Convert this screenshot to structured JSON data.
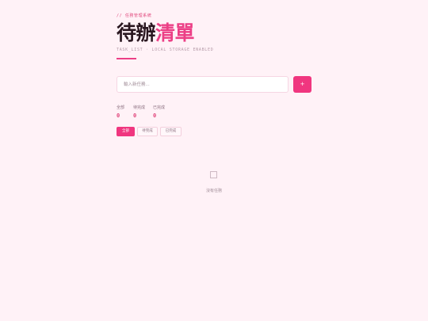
{
  "header": {
    "eyebrow": "// 任務管理系統",
    "title_dark": "待辦",
    "title_accent": "清單",
    "subtitle": "TASK_LIST · LOCAL STORAGE ENABLED"
  },
  "input": {
    "placeholder": "輸入新任務...",
    "value": "",
    "add_label": "+"
  },
  "stats": [
    {
      "label": "全部",
      "value": "0"
    },
    {
      "label": "待完成",
      "value": "0"
    },
    {
      "label": "已完成",
      "value": "0"
    }
  ],
  "filters": [
    {
      "label": "全部",
      "active": true
    },
    {
      "label": "待完成",
      "active": false
    },
    {
      "label": "已完成",
      "active": false
    }
  ],
  "empty_state": {
    "icon": "empty-box-icon",
    "text": "沒有任務"
  },
  "colors": {
    "background": "#fff2f7",
    "accent": "#f0367f",
    "title_dark": "#2a1720"
  }
}
